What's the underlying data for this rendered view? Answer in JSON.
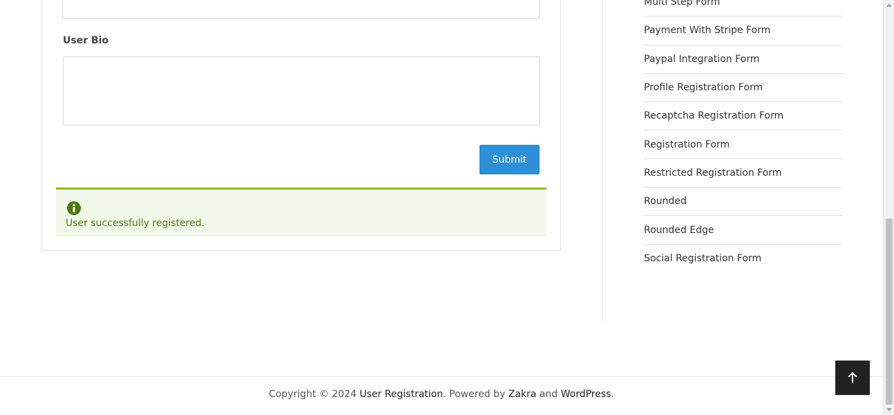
{
  "form": {
    "bio_label": "User Bio",
    "bio_value": "",
    "submit_label": "Submit",
    "success_message": "User successfully registered."
  },
  "sidebar": {
    "items": [
      {
        "label": "Multi Step Form"
      },
      {
        "label": "Payment With Stripe Form"
      },
      {
        "label": "Paypal Integration Form"
      },
      {
        "label": "Profile Registration Form"
      },
      {
        "label": "Recaptcha Registration Form"
      },
      {
        "label": "Registration Form"
      },
      {
        "label": "Restricted Registration Form"
      },
      {
        "label": "Rounded"
      },
      {
        "label": "Rounded Edge"
      },
      {
        "label": "Social Registration Form"
      }
    ]
  },
  "footer": {
    "copyright_prefix": "Copyright © 2024 ",
    "site_link": "User Registration",
    "powered_by": ". Powered by ",
    "theme_link": "Zakra",
    "and": " and ",
    "wp_link": "WordPress",
    "period": "."
  },
  "icons": {
    "info": "info-icon",
    "scroll_top": "arrow-up-icon"
  },
  "colors": {
    "accent": "#2e8fd6",
    "success_border": "#8fbb1b",
    "success_bg": "#f1f8e9",
    "success_text": "#4d7a0e",
    "info_icon": "#4d7a0e",
    "scroll_top_bg": "#222222"
  }
}
